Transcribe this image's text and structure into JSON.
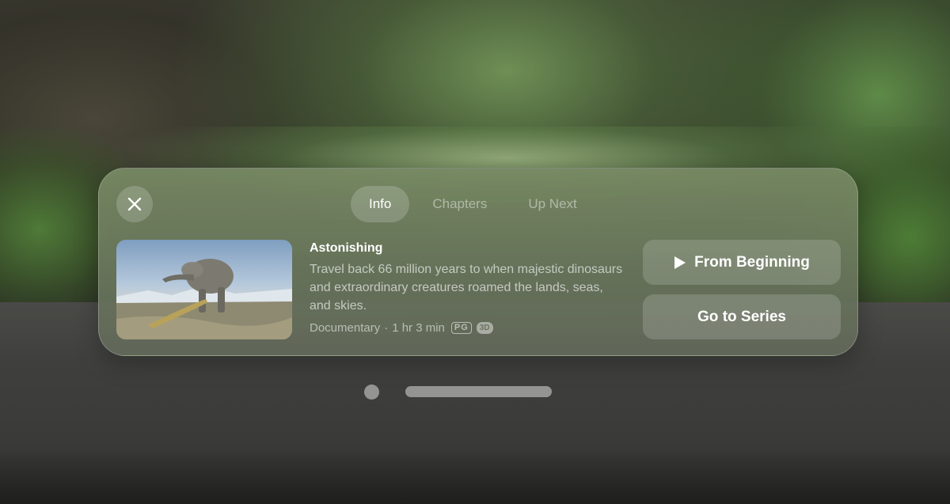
{
  "tabs": [
    {
      "label": "Info",
      "active": true
    },
    {
      "label": "Chapters",
      "active": false
    },
    {
      "label": "Up Next",
      "active": false
    }
  ],
  "episode": {
    "title": "Astonishing",
    "description": "Travel back 66 million years to when majestic dinosaurs and extraordinary creatures roamed the lands, seas, and skies.",
    "genre": "Documentary",
    "separator": "·",
    "duration": "1 hr 3 min",
    "rating": "PG",
    "format_badge": "3D"
  },
  "buttons": {
    "from_beginning": "From Beginning",
    "go_to_series": "Go to Series"
  },
  "icons": {
    "close": "close-icon",
    "play": "play-icon"
  }
}
